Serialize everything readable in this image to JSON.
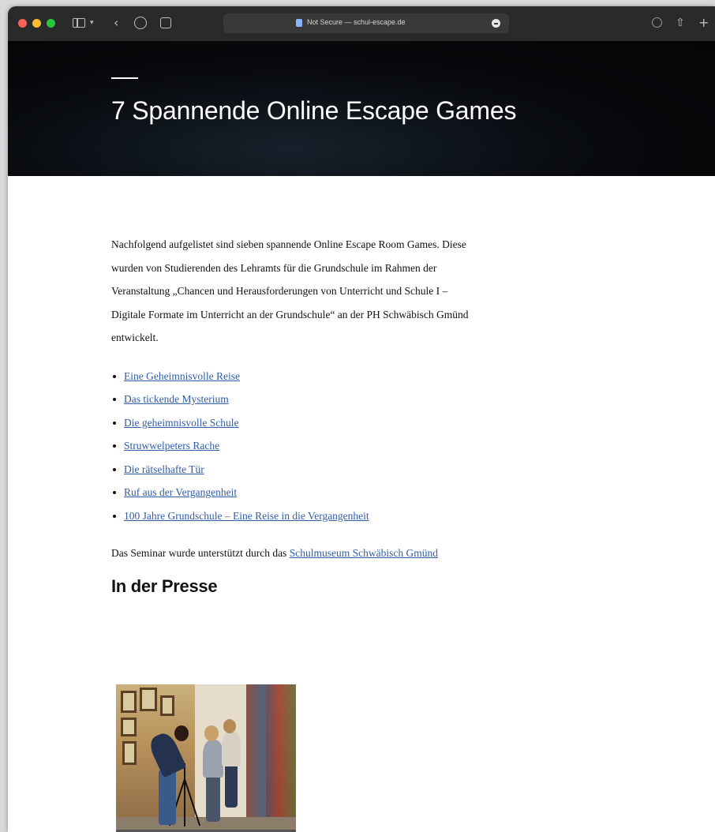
{
  "browser": {
    "url_text": "Not Secure — schul-escape.de"
  },
  "hero": {
    "title": "7 Spannende Online Escape Games"
  },
  "content": {
    "intro": "Nachfolgend aufgelistet sind sieben spannende Online Escape Room Games. Diese wurden von Studierenden des Lehramts für die Grundschule im Rahmen der Veranstaltung „Chancen und Herausforderungen von Unterricht und Schule I – Digitale Formate im Unterricht an der Grundschule“ an der PH Schwäbisch Gmünd entwickelt.",
    "links": [
      "Eine Geheimnisvolle Reise",
      "Das tickende Mysterium",
      "Die geheimnisvolle Schule",
      "Struwwelpeters Rache",
      "Die rätselhafte Tür",
      "Ruf aus der Vergangenheit",
      "100 Jahre Grundschule – Eine Reise in die Vergangenheit"
    ],
    "support_text": "Das Seminar wurde unterstützt durch das ",
    "support_link": "Schulmuseum Schwäbisch Gmünd",
    "press_heading": "In der Presse"
  },
  "colors": {
    "toolbar_bg": "#2b2a2b",
    "hero_bg": "#07090c",
    "link": "#2f5da8"
  }
}
